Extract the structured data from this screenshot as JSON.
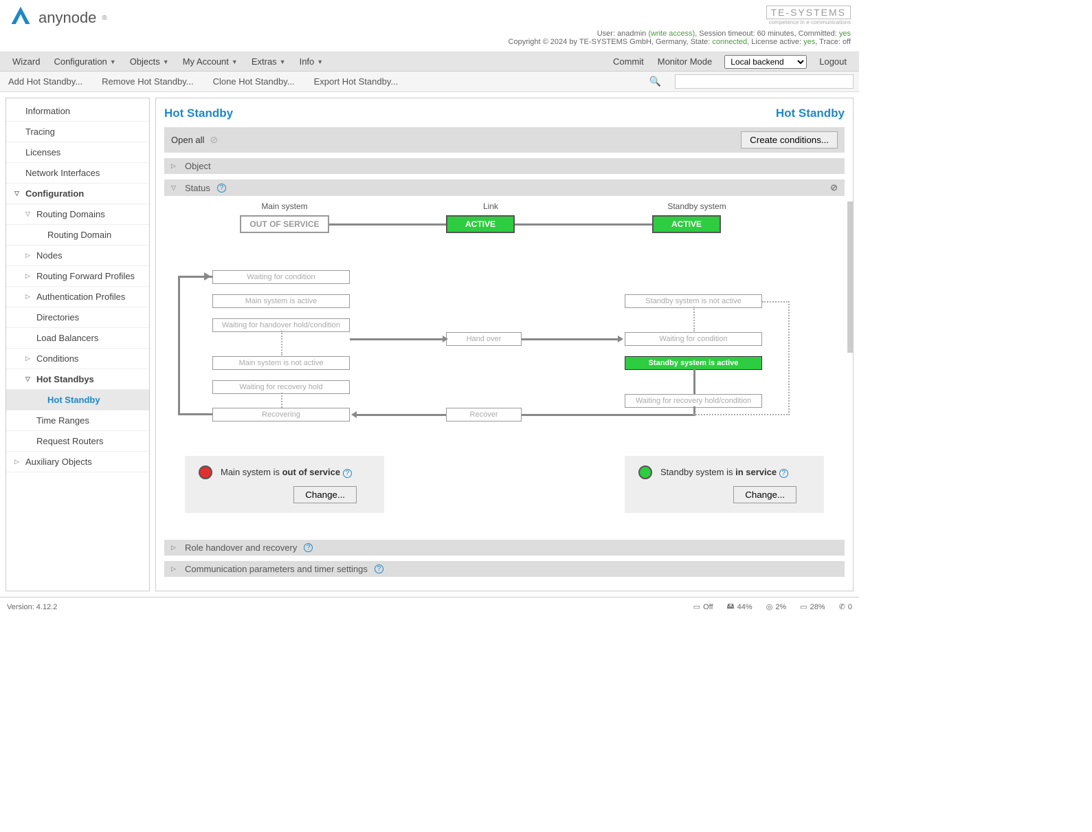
{
  "header": {
    "brand": "anynode",
    "te_logo": "TE-SYSTEMS",
    "te_sub": "competence in e-communications",
    "user_label": "User: ",
    "user": "anadmin",
    "access": " (write access)",
    "session": ", Session timeout: 60 minutes, Committed: ",
    "committed": "yes",
    "copyright": "Copyright © 2024 by TE-SYSTEMS GmbH, Germany, State: ",
    "state": "connected",
    "license_label": ", License active: ",
    "license": "yes",
    "trace_label": ", Trace: ",
    "trace": "off"
  },
  "menubar": {
    "items": [
      "Wizard",
      "Configuration",
      "Objects",
      "My Account",
      "Extras",
      "Info"
    ],
    "commit": "Commit",
    "monitor": "Monitor Mode",
    "backend": "Local backend",
    "logout": "Logout"
  },
  "toolbar": {
    "items": [
      "Add Hot Standby...",
      "Remove Hot Standby...",
      "Clone Hot Standby...",
      "Export Hot Standby..."
    ]
  },
  "sidebar": {
    "information": "Information",
    "tracing": "Tracing",
    "licenses": "Licenses",
    "network": "Network Interfaces",
    "configuration": "Configuration",
    "routing_domains": "Routing Domains",
    "routing_domain": "Routing Domain",
    "nodes": "Nodes",
    "rfp": "Routing Forward Profiles",
    "auth": "Authentication Profiles",
    "directories": "Directories",
    "lb": "Load Balancers",
    "conditions": "Conditions",
    "hot_standbys": "Hot Standbys",
    "hot_standby": "Hot Standby",
    "time_ranges": "Time Ranges",
    "request_routers": "Request Routers",
    "aux": "Auxiliary Objects"
  },
  "content": {
    "title_left": "Hot Standby",
    "title_right": "Hot Standby",
    "open_all": "Open all",
    "create_conditions": "Create conditions...",
    "object": "Object",
    "status": "Status",
    "role_handover": "Role handover and recovery",
    "comm_params": "Communication parameters and timer settings"
  },
  "diagram": {
    "main_label": "Main system",
    "link_label": "Link",
    "standby_label": "Standby system",
    "main_status": "OUT OF SERVICE",
    "link_status": "ACTIVE",
    "standby_status": "ACTIVE",
    "states": {
      "m1": "Waiting for condition",
      "m2": "Main system is active",
      "m3": "Waiting for handover hold/condition",
      "m4": "Main system is not active",
      "m5": "Waiting for recovery hold",
      "m6": "Recovering",
      "hand_over": "Hand over",
      "recover": "Recover",
      "s1": "Standby system is not active",
      "s2": "Waiting for condition",
      "s3": "Standby system is active",
      "s4": "Waiting for recovery hold/condition"
    }
  },
  "status_cards": {
    "main_prefix": "Main system is ",
    "main_status": "out of service",
    "standby_prefix": "Standby system is ",
    "standby_status": "in service",
    "change": "Change..."
  },
  "footer": {
    "version": "Version: 4.12.2",
    "off": "Off",
    "disk": "44%",
    "cpu": "2%",
    "mem": "28%",
    "calls": "0"
  }
}
